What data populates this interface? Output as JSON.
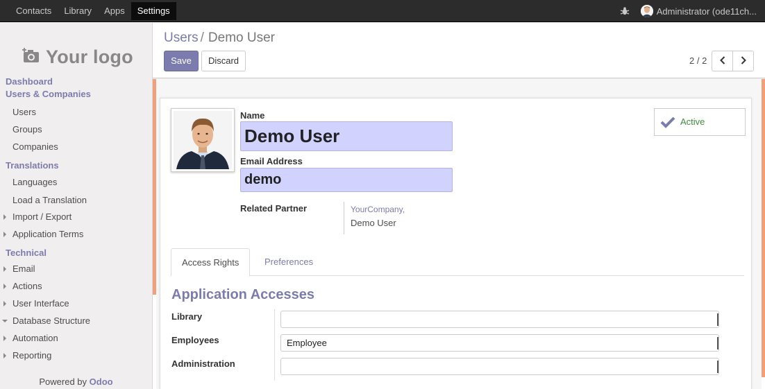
{
  "topbar": {
    "menu": [
      "Contacts",
      "Library",
      "Apps",
      "Settings"
    ],
    "active_menu": "Settings",
    "user": "Administrator (ode11ch..."
  },
  "sidebar": {
    "logo_text": "Your logo",
    "sections": [
      {
        "title": "Dashboard",
        "items": []
      },
      {
        "title": "Users & Companies",
        "items": [
          {
            "label": "Users",
            "caret": "none"
          },
          {
            "label": "Groups",
            "caret": "none"
          },
          {
            "label": "Companies",
            "caret": "none"
          }
        ]
      },
      {
        "title": "Translations",
        "items": [
          {
            "label": "Languages",
            "caret": "none"
          },
          {
            "label": "Load a Translation",
            "caret": "none"
          },
          {
            "label": "Import / Export",
            "caret": "right"
          },
          {
            "label": "Application Terms",
            "caret": "right"
          }
        ]
      },
      {
        "title": "Technical",
        "items": [
          {
            "label": "Email",
            "caret": "right"
          },
          {
            "label": "Actions",
            "caret": "right"
          },
          {
            "label": "User Interface",
            "caret": "right"
          },
          {
            "label": "Database Structure",
            "caret": "down"
          },
          {
            "label": "Automation",
            "caret": "right"
          },
          {
            "label": "Reporting",
            "caret": "right"
          }
        ]
      }
    ],
    "powered_by": "Powered by",
    "powered_brand": "Odoo"
  },
  "control_panel": {
    "breadcrumb_parent": "Users",
    "breadcrumb_sep": "/",
    "breadcrumb_current": "Demo User",
    "save_label": "Save",
    "discard_label": "Discard",
    "pager": "2 / 2"
  },
  "form": {
    "name_label": "Name",
    "name_value": "Demo User",
    "email_label": "Email Address",
    "email_value": "demo",
    "partner_label": "Related Partner",
    "partner_company": "YourCompany,",
    "partner_name": "Demo User",
    "active_label": "Active",
    "tabs": [
      "Access Rights",
      "Preferences"
    ],
    "active_tab": "Access Rights",
    "section_title": "Application Accesses",
    "accesses": [
      {
        "label": "Library",
        "value": ""
      },
      {
        "label": "Employees",
        "value": "Employee"
      },
      {
        "label": "Administration",
        "value": ""
      }
    ]
  },
  "colors": {
    "brand": "#7c7bad",
    "active_green": "#3d8d3d",
    "required_field": "#d2d2ff",
    "ribbon": "#f0a07a"
  }
}
